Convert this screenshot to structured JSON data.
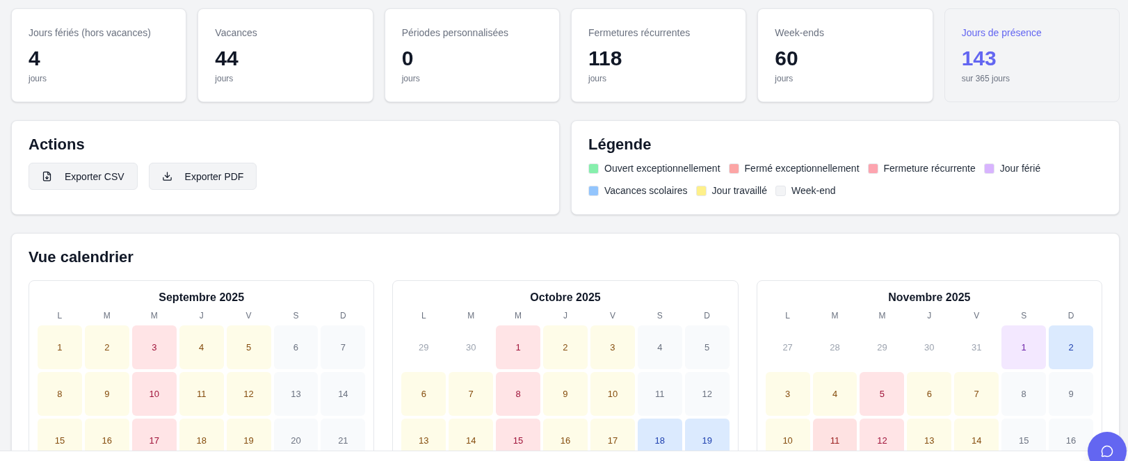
{
  "stats": [
    {
      "label": "Jours fériés (hors vacances)",
      "value": "4",
      "unit": "jours",
      "highlighted": false
    },
    {
      "label": "Vacances",
      "value": "44",
      "unit": "jours",
      "highlighted": false
    },
    {
      "label": "Périodes personnalisées",
      "value": "0",
      "unit": "jours",
      "highlighted": false
    },
    {
      "label": "Fermetures récurrentes",
      "value": "118",
      "unit": "jours",
      "highlighted": false
    },
    {
      "label": "Week-ends",
      "value": "60",
      "unit": "jours",
      "highlighted": false
    },
    {
      "label": "Jours de présence",
      "value": "143",
      "unit": "sur 365 jours",
      "highlighted": true
    }
  ],
  "actions": {
    "title": "Actions",
    "buttons": [
      {
        "label": "Exporter CSV"
      },
      {
        "label": "Exporter PDF"
      }
    ]
  },
  "legend": {
    "title": "Légende",
    "items": [
      {
        "label": "Ouvert exceptionnellement",
        "color": "#86efac"
      },
      {
        "label": "Fermé exceptionnellement",
        "color": "#fca5a5"
      },
      {
        "label": "Fermeture récurrente",
        "color": "#fda4af"
      },
      {
        "label": "Jour férié",
        "color": "#d8b4fe"
      },
      {
        "label": "Vacances scolaires",
        "color": "#93c5fd"
      },
      {
        "label": "Jour travaillé",
        "color": "#fef08a"
      },
      {
        "label": "Week-end",
        "color": "#f3f4f6"
      }
    ]
  },
  "calendar": {
    "title": "Vue calendrier",
    "months": [
      {
        "title": "Septembre 2025",
        "weekdays": [
          "L",
          "M",
          "M",
          "J",
          "V",
          "S",
          "D"
        ],
        "days": [
          {
            "day": "1",
            "kind": "worked"
          },
          {
            "day": "2",
            "kind": "worked"
          },
          {
            "day": "3",
            "kind": "recurring"
          },
          {
            "day": "4",
            "kind": "worked"
          },
          {
            "day": "5",
            "kind": "worked"
          },
          {
            "day": "6",
            "kind": "weekend"
          },
          {
            "day": "7",
            "kind": "weekend"
          },
          {
            "day": "8",
            "kind": "worked"
          },
          {
            "day": "9",
            "kind": "worked"
          },
          {
            "day": "10",
            "kind": "recurring"
          },
          {
            "day": "11",
            "kind": "worked"
          },
          {
            "day": "12",
            "kind": "worked"
          },
          {
            "day": "13",
            "kind": "weekend"
          },
          {
            "day": "14",
            "kind": "weekend"
          },
          {
            "day": "15",
            "kind": "worked"
          },
          {
            "day": "16",
            "kind": "worked"
          },
          {
            "day": "17",
            "kind": "recurring"
          },
          {
            "day": "18",
            "kind": "worked"
          },
          {
            "day": "19",
            "kind": "worked"
          },
          {
            "day": "20",
            "kind": "weekend"
          },
          {
            "day": "21",
            "kind": "weekend"
          }
        ]
      },
      {
        "title": "Octobre 2025",
        "weekdays": [
          "L",
          "M",
          "M",
          "J",
          "V",
          "S",
          "D"
        ],
        "days": [
          {
            "day": "29",
            "kind": "outside"
          },
          {
            "day": "30",
            "kind": "outside"
          },
          {
            "day": "1",
            "kind": "recurring"
          },
          {
            "day": "2",
            "kind": "worked"
          },
          {
            "day": "3",
            "kind": "worked"
          },
          {
            "day": "4",
            "kind": "weekend"
          },
          {
            "day": "5",
            "kind": "weekend"
          },
          {
            "day": "6",
            "kind": "worked"
          },
          {
            "day": "7",
            "kind": "worked"
          },
          {
            "day": "8",
            "kind": "recurring"
          },
          {
            "day": "9",
            "kind": "worked"
          },
          {
            "day": "10",
            "kind": "worked"
          },
          {
            "day": "11",
            "kind": "weekend"
          },
          {
            "day": "12",
            "kind": "weekend"
          },
          {
            "day": "13",
            "kind": "worked"
          },
          {
            "day": "14",
            "kind": "worked"
          },
          {
            "day": "15",
            "kind": "recurring"
          },
          {
            "day": "16",
            "kind": "worked"
          },
          {
            "day": "17",
            "kind": "worked"
          },
          {
            "day": "18",
            "kind": "vacation"
          },
          {
            "day": "19",
            "kind": "vacation"
          }
        ]
      },
      {
        "title": "Novembre 2025",
        "weekdays": [
          "L",
          "M",
          "M",
          "J",
          "V",
          "S",
          "D"
        ],
        "days": [
          {
            "day": "27",
            "kind": "outside"
          },
          {
            "day": "28",
            "kind": "outside"
          },
          {
            "day": "29",
            "kind": "outside"
          },
          {
            "day": "30",
            "kind": "outside"
          },
          {
            "day": "31",
            "kind": "outside"
          },
          {
            "day": "1",
            "kind": "holiday"
          },
          {
            "day": "2",
            "kind": "vacation"
          },
          {
            "day": "3",
            "kind": "worked"
          },
          {
            "day": "4",
            "kind": "worked"
          },
          {
            "day": "5",
            "kind": "recurring"
          },
          {
            "day": "6",
            "kind": "worked"
          },
          {
            "day": "7",
            "kind": "worked"
          },
          {
            "day": "8",
            "kind": "weekend"
          },
          {
            "day": "9",
            "kind": "weekend"
          },
          {
            "day": "10",
            "kind": "worked"
          },
          {
            "day": "11",
            "kind": "closed"
          },
          {
            "day": "12",
            "kind": "recurring"
          },
          {
            "day": "13",
            "kind": "worked"
          },
          {
            "day": "14",
            "kind": "worked"
          },
          {
            "day": "15",
            "kind": "weekend"
          },
          {
            "day": "16",
            "kind": "weekend"
          }
        ]
      }
    ]
  }
}
